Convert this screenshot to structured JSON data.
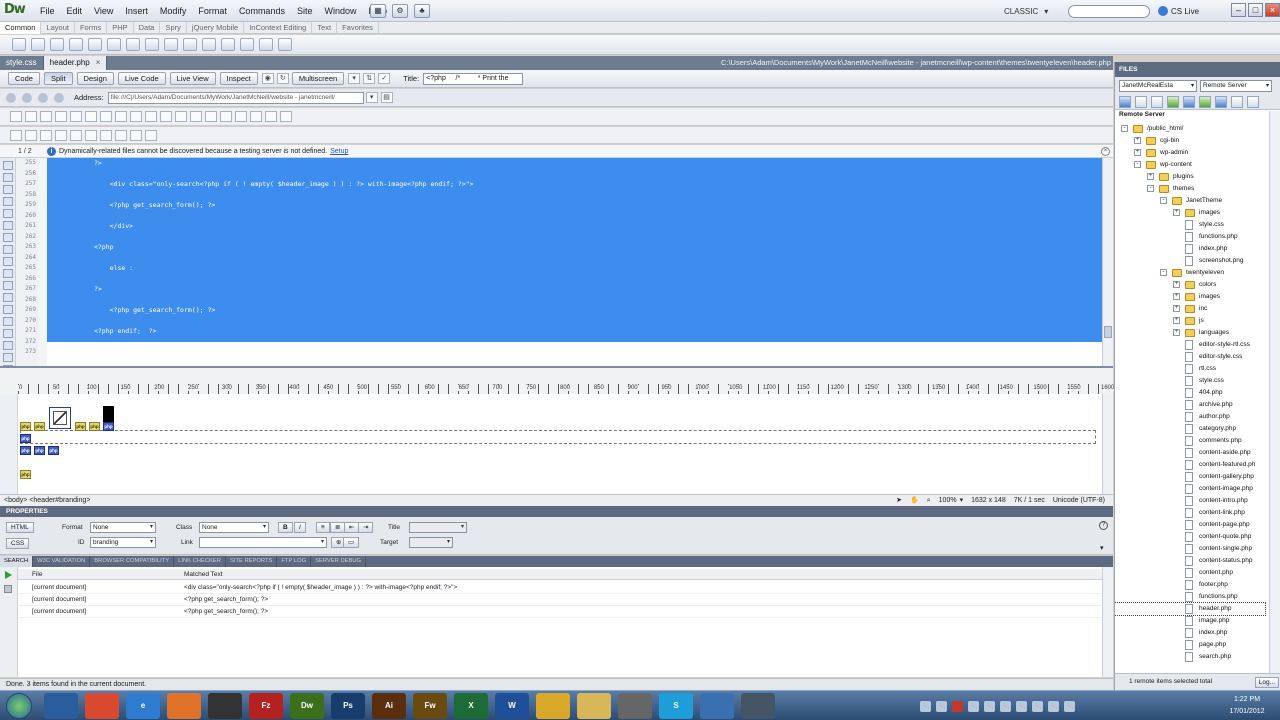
{
  "app": {
    "logo": "Dw",
    "menus": [
      "File",
      "Edit",
      "View",
      "Insert",
      "Modify",
      "Format",
      "Commands",
      "Site",
      "Window",
      "Help"
    ],
    "workspace": "CLASSIC",
    "cs_live": "CS Live"
  },
  "insert_panel": {
    "tabs": [
      "Common",
      "Layout",
      "Forms",
      "PHP",
      "Data",
      "Spry",
      "jQuery Mobile",
      "InContext Editing",
      "Text",
      "Favorites"
    ]
  },
  "doc_tabs": {
    "tabs": [
      "style.css",
      "header.php"
    ],
    "path": "C:\\Users\\Adam\\Documents\\MyWork\\JanetMcNeill\\website - janetmcneill\\wp-content\\themes\\twentyeleven\\header.php"
  },
  "doc_toolbar": {
    "code": "Code",
    "split": "Split",
    "design": "Design",
    "live_code": "Live Code",
    "live_view": "Live View",
    "inspect": "Inspect",
    "multiscreen": "Multiscreen",
    "title_label": "Title:",
    "title_value": "<?php     /*         * Print the"
  },
  "nav_toolbar": {
    "address_label": "Address:",
    "address_value": "file:///C|/Users/Adam/Documents/MyWork/JanetMcNeill/website - janetmcneill/"
  },
  "info_bar": {
    "page": "1 / 2",
    "message": "Dynamically-related files cannot be discovered because a testing server is not defined.",
    "link": "Setup"
  },
  "code": {
    "line_numbers": [
      "255",
      "256",
      "257",
      "258",
      "259",
      "260",
      "261",
      "262",
      "263",
      "264",
      "265",
      "266",
      "267",
      "268",
      "269",
      "270",
      "271",
      "272",
      "273"
    ],
    "lines": [
      "            ?>",
      "",
      "                <div class=\"only-search<?php if ( ! empty( $header_image ) ) : ?> with-image<?php endif; ?>\">",
      "",
      "                <?php get_search_form(); ?>",
      "",
      "                </div>",
      "",
      "            <?php",
      "",
      "                else :",
      "",
      "            ?>",
      "",
      "                <?php get_search_form(); ?>",
      "",
      "            <?php endif;  ?>",
      "",
      ""
    ]
  },
  "ruler": {
    "labels": [
      "0",
      "50",
      "100",
      "150",
      "200",
      "250",
      "300",
      "350",
      "400",
      "450",
      "500",
      "550",
      "600",
      "650",
      "700",
      "750",
      "800",
      "850",
      "900",
      "950",
      "1000",
      "1050",
      "1100",
      "1150",
      "1200",
      "1250",
      "1300",
      "1350",
      "1400",
      "1450",
      "1500",
      "1550",
      "1600"
    ]
  },
  "status_bar": {
    "tag_selector": "<body> <header#branding>",
    "zoom": "100%",
    "dimensions": "1632 x 148",
    "file_size": "7K / 1 sec",
    "encoding": "Unicode (UTF-8)"
  },
  "properties": {
    "header": "PROPERTIES",
    "html_btn": "HTML",
    "css_btn": "CSS",
    "format_label": "Format",
    "format_value": "None",
    "class_label": "Class",
    "class_value": "None",
    "id_label": "ID",
    "id_value": "branding",
    "link_label": "Link",
    "title_label": "Title",
    "target_label": "Target",
    "bold": "B",
    "italic": "I"
  },
  "results": {
    "tabs": [
      "SEARCH",
      "W3C VALIDATION",
      "BROWSER COMPATIBILITY",
      "LINK CHECKER",
      "SITE REPORTS",
      "FTP LOG",
      "SERVER DEBUG"
    ],
    "col_file": "File",
    "col_match": "Matched Text",
    "rows": [
      {
        "file": "[current document]",
        "match": "<div class=\"only-search<?php if ( ! empty( $header_image ) ) : ?> with-image<?php endif; ?>\">"
      },
      {
        "file": "[current document]",
        "match": "<?php get_search_form(); ?>"
      },
      {
        "file": "[current document]",
        "match": "<?php get_search_form(); ?>"
      }
    ],
    "status": "Done. 3 items found in the current document."
  },
  "files": {
    "header": "FILES",
    "site": "JanetMcRealEsta",
    "server": "Remote Server",
    "tree_header": "Remote Server",
    "items": [
      {
        "label": "/public_html/",
        "depth": 0,
        "kind": "folder",
        "exp": "-"
      },
      {
        "label": "cgi-bin",
        "depth": 1,
        "kind": "folder",
        "exp": "+"
      },
      {
        "label": "wp-admin",
        "depth": 1,
        "kind": "folder",
        "exp": "+"
      },
      {
        "label": "wp-content",
        "depth": 1,
        "kind": "folder",
        "exp": "-"
      },
      {
        "label": "plugins",
        "depth": 2,
        "kind": "folder",
        "exp": "+"
      },
      {
        "label": "themes",
        "depth": 2,
        "kind": "folder",
        "exp": "-"
      },
      {
        "label": "JanetTheme",
        "depth": 3,
        "kind": "folder",
        "exp": "-"
      },
      {
        "label": "images",
        "depth": 4,
        "kind": "folder",
        "exp": "+"
      },
      {
        "label": "style.css",
        "depth": 4,
        "kind": "file",
        "exp": ""
      },
      {
        "label": "functions.php",
        "depth": 4,
        "kind": "file",
        "exp": ""
      },
      {
        "label": "index.php",
        "depth": 4,
        "kind": "file",
        "exp": ""
      },
      {
        "label": "screenshot.png",
        "depth": 4,
        "kind": "file",
        "exp": ""
      },
      {
        "label": "twentyeleven",
        "depth": 3,
        "kind": "folder",
        "exp": "-"
      },
      {
        "label": "colors",
        "depth": 4,
        "kind": "folder",
        "exp": "+"
      },
      {
        "label": "images",
        "depth": 4,
        "kind": "folder",
        "exp": "+"
      },
      {
        "label": "inc",
        "depth": 4,
        "kind": "folder",
        "exp": "+"
      },
      {
        "label": "js",
        "depth": 4,
        "kind": "folder",
        "exp": "+"
      },
      {
        "label": "languages",
        "depth": 4,
        "kind": "folder",
        "exp": "+"
      },
      {
        "label": "editor-style-rtl.css",
        "depth": 4,
        "kind": "file",
        "exp": ""
      },
      {
        "label": "editor-style.css",
        "depth": 4,
        "kind": "file",
        "exp": ""
      },
      {
        "label": "rtl.css",
        "depth": 4,
        "kind": "file",
        "exp": ""
      },
      {
        "label": "style.css",
        "depth": 4,
        "kind": "file",
        "exp": ""
      },
      {
        "label": "404.php",
        "depth": 4,
        "kind": "file",
        "exp": ""
      },
      {
        "label": "archive.php",
        "depth": 4,
        "kind": "file",
        "exp": ""
      },
      {
        "label": "author.php",
        "depth": 4,
        "kind": "file",
        "exp": ""
      },
      {
        "label": "category.php",
        "depth": 4,
        "kind": "file",
        "exp": ""
      },
      {
        "label": "comments.php",
        "depth": 4,
        "kind": "file",
        "exp": ""
      },
      {
        "label": "content-aside.php",
        "depth": 4,
        "kind": "file",
        "exp": ""
      },
      {
        "label": "content-featured.ph",
        "depth": 4,
        "kind": "file",
        "exp": ""
      },
      {
        "label": "content-gallery.php",
        "depth": 4,
        "kind": "file",
        "exp": ""
      },
      {
        "label": "content-image.php",
        "depth": 4,
        "kind": "file",
        "exp": ""
      },
      {
        "label": "content-intro.php",
        "depth": 4,
        "kind": "file",
        "exp": ""
      },
      {
        "label": "content-link.php",
        "depth": 4,
        "kind": "file",
        "exp": ""
      },
      {
        "label": "content-page.php",
        "depth": 4,
        "kind": "file",
        "exp": ""
      },
      {
        "label": "content-quote.php",
        "depth": 4,
        "kind": "file",
        "exp": ""
      },
      {
        "label": "content-single.php",
        "depth": 4,
        "kind": "file",
        "exp": ""
      },
      {
        "label": "content-status.php",
        "depth": 4,
        "kind": "file",
        "exp": ""
      },
      {
        "label": "content.php",
        "depth": 4,
        "kind": "file",
        "exp": ""
      },
      {
        "label": "footer.php",
        "depth": 4,
        "kind": "file",
        "exp": ""
      },
      {
        "label": "functions.php",
        "depth": 4,
        "kind": "file",
        "exp": ""
      },
      {
        "label": "header.php",
        "depth": 4,
        "kind": "file",
        "exp": "",
        "selected": true
      },
      {
        "label": "image.php",
        "depth": 4,
        "kind": "file",
        "exp": ""
      },
      {
        "label": "index.php",
        "depth": 4,
        "kind": "file",
        "exp": ""
      },
      {
        "label": "page.php",
        "depth": 4,
        "kind": "file",
        "exp": ""
      },
      {
        "label": "search.php",
        "depth": 4,
        "kind": "file",
        "exp": ""
      }
    ],
    "status": "1 remote items selected total",
    "log_btn": "Log..."
  },
  "taskbar": {
    "apps": [
      {
        "name": "windows-media-icon",
        "label": "",
        "color": "#2a5d9c"
      },
      {
        "name": "chrome-icon",
        "label": "",
        "color": "#d9492f"
      },
      {
        "name": "internet-explorer-icon",
        "label": "e",
        "color": "#2d7ccf"
      },
      {
        "name": "firefox-icon",
        "label": "",
        "color": "#e0722a"
      },
      {
        "name": "unity-icon",
        "label": "",
        "color": "#333333"
      },
      {
        "name": "filezilla-icon",
        "label": "Fz",
        "color": "#b52020"
      },
      {
        "name": "dreamweaver-icon",
        "label": "Dw",
        "color": "#3c6f1c"
      },
      {
        "name": "photoshop-icon",
        "label": "Ps",
        "color": "#163d6b"
      },
      {
        "name": "illustrator-icon",
        "label": "Ai",
        "color": "#5a2d0c"
      },
      {
        "name": "fireworks-icon",
        "label": "Fw",
        "color": "#6b4a12"
      },
      {
        "name": "excel-icon",
        "label": "X",
        "color": "#1d6b36"
      },
      {
        "name": "word-icon",
        "label": "W",
        "color": "#1f4f99"
      },
      {
        "name": "outlook-icon",
        "label": "",
        "color": "#d9a82a"
      },
      {
        "name": "explorer-icon",
        "label": "",
        "color": "#d8b65a"
      },
      {
        "name": "cd-icon",
        "label": "",
        "color": "#666666"
      },
      {
        "name": "skype-icon",
        "label": "S",
        "color": "#1d9ed8"
      },
      {
        "name": "itunes-icon",
        "label": "",
        "color": "#3a70b0"
      },
      {
        "name": "misc-app-icon",
        "label": "",
        "color": "#445566"
      }
    ],
    "time": "1:22 PM",
    "date": "17/01/2012"
  }
}
